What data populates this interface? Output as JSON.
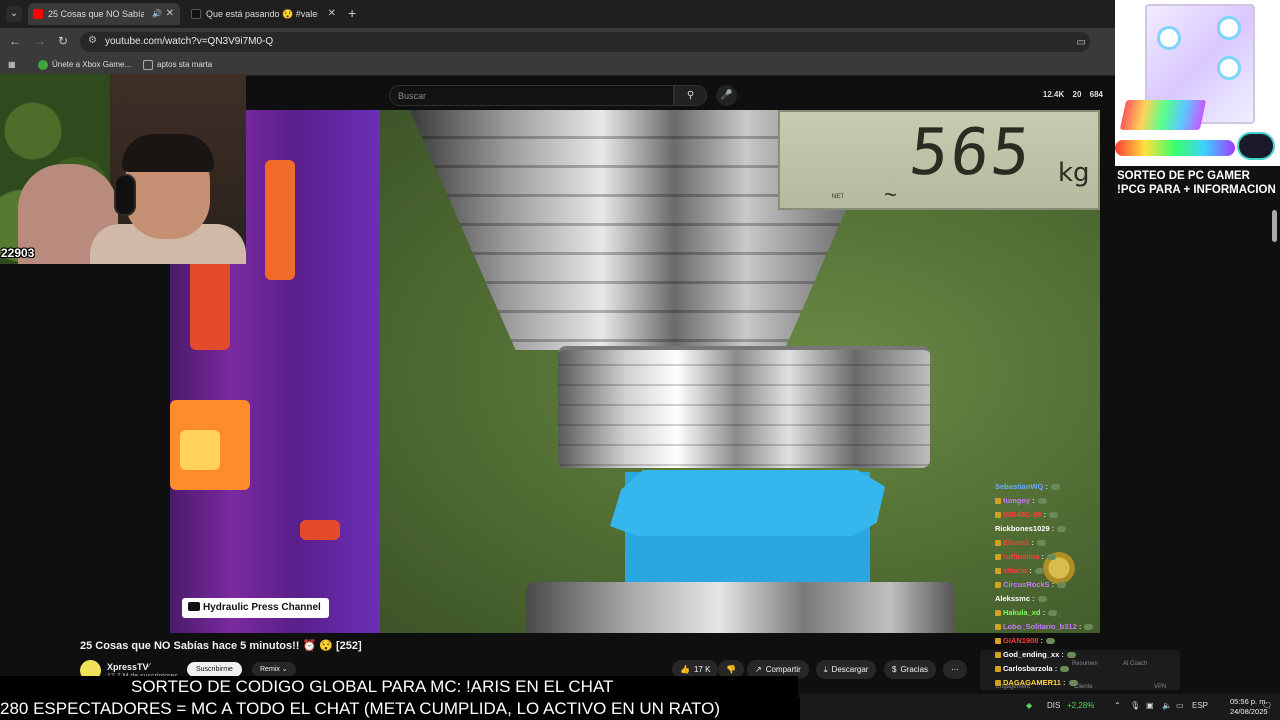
{
  "browser": {
    "tabs": [
      {
        "title": "25 Cosas que NO Sabías hace 5 minutos",
        "favicon_color": "#ff0000",
        "audio": true,
        "active": true
      },
      {
        "title": "Que está pasando 😯 #valencia",
        "favicon_color": "#111111",
        "audio": false,
        "active": false
      }
    ],
    "url": "youtube.com/watch?v=QN3V9i7M0-Q",
    "bookmarks": [
      {
        "label": "Únete a Xbox Game...",
        "icon_color": "#3fa33f"
      },
      {
        "label": "aptos sta marta",
        "icon_color": "#888888"
      }
    ]
  },
  "youtube": {
    "search_placeholder": "Buscar",
    "stats": {
      "views_a": "12.4K",
      "views_b": "20",
      "views_c": "684"
    },
    "video_title": "25 Cosas que NO Sabías hace 5 minutos!! ⏰ 😯 [252]",
    "channel": {
      "name": "XpressTV",
      "verified": "✓",
      "subs": "17,7 M de suscriptores"
    },
    "subscribe_label": "Suscribirme",
    "remix_label": "Remix",
    "likes": "17 K",
    "share_label": "Compartir",
    "download_label": "Descargar",
    "thanks_label": "Gracias",
    "more_label": "⋯"
  },
  "video": {
    "scale_value": "565",
    "scale_unit": "kg",
    "scale_net": "NET",
    "watermark": "Hydraulic Press Channel"
  },
  "webcam": {
    "counter": "22903"
  },
  "ad": {
    "line1": "SORTEO DE PC GAMER",
    "line2": "!PCG PARA + INFORMACION"
  },
  "chat": {
    "messages": [
      {
        "user": "SebastianWQ",
        "color": "#6aa8ff"
      },
      {
        "user": "tumgoy",
        "color": "#c678ff"
      },
      {
        "user": "83B48C-99",
        "color": "#ff3b3b"
      },
      {
        "user": "Rickbones1029",
        "color": "#ffffff"
      },
      {
        "user": "Eliseo1",
        "color": "#ff3b3b"
      },
      {
        "user": "ruffinalma",
        "color": "#ff3b3b"
      },
      {
        "user": "xlfacto",
        "color": "#ff3b3b"
      },
      {
        "user": "CircusRockS",
        "color": "#c678ff"
      },
      {
        "user": "Alekssmc",
        "color": "#ffffff"
      },
      {
        "user": "Hakula_xd",
        "color": "#7dff5a"
      },
      {
        "user": "Lobo_Solitario_b312",
        "color": "#c678ff"
      },
      {
        "user": "GIAN1908",
        "color": "#ff3b3b"
      },
      {
        "user": "God_ending_xx",
        "color": "#ffffff"
      },
      {
        "user": "Carlosbarzola",
        "color": "#ffffff"
      },
      {
        "user": "DAGAGAMER11",
        "color": "#ffd23b"
      }
    ],
    "panel_items": [
      "Resumen",
      "Al Coach",
      "Engagement",
      "Cliente",
      "VPN"
    ]
  },
  "overlays": {
    "line1": "SORTEO DE CODIGO GLOBAL PARA MC: !ARIS EN EL CHAT",
    "line2": "280 ESPECTADORES = MC A TODO EL CHAT (META CUMPLIDA, LO ACTIVO EN UN RATO)"
  },
  "taskbar": {
    "market": "DIS",
    "change": "+2,28%",
    "lang": "ESP",
    "time": "05:56 p. m.",
    "date": "24/08/2025"
  }
}
